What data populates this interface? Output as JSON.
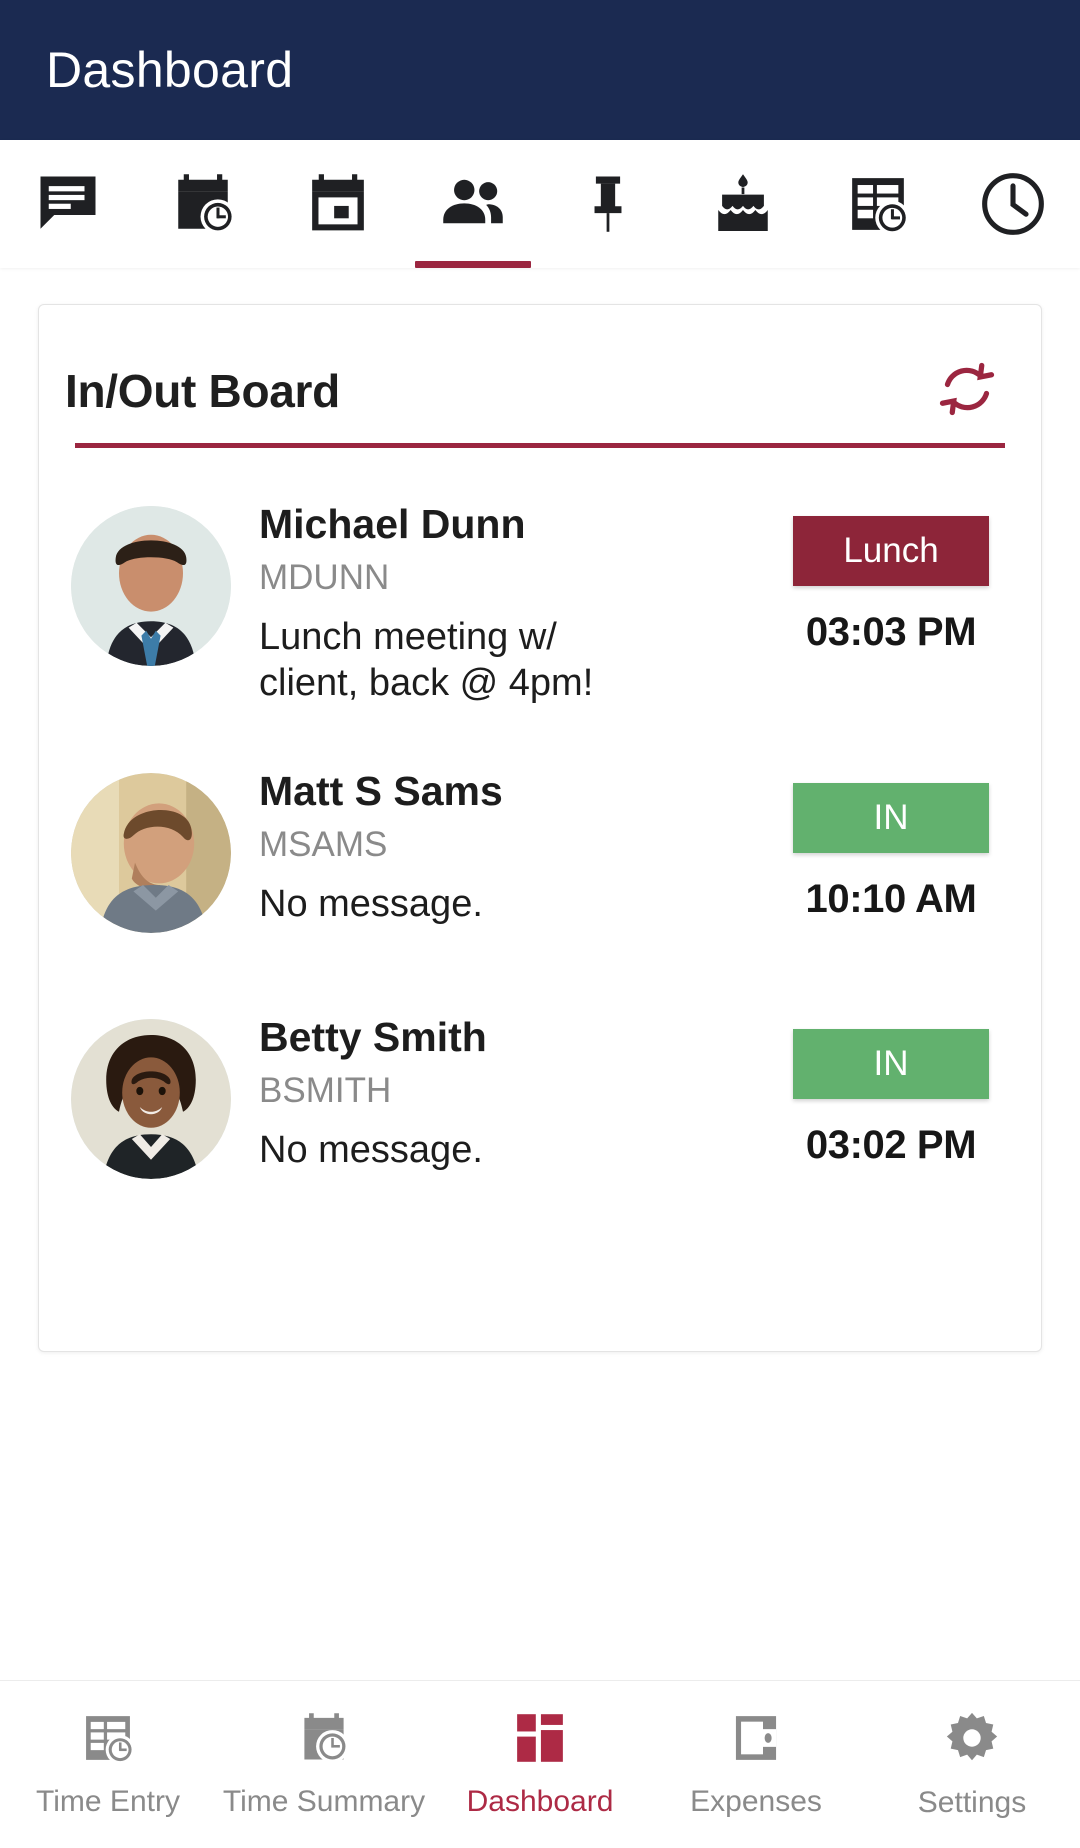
{
  "appbar": {
    "title": "Dashboard"
  },
  "colors": {
    "header_bg": "#1b2a51",
    "accent": "#9b2640",
    "badge_out": "#8d2539",
    "badge_in": "#62b16e",
    "muted_text": "#8a8a8a",
    "nav_active": "#ad2a45"
  },
  "tabs": [
    {
      "name": "messages-tab",
      "icon": "chat-bubble-icon",
      "active": false
    },
    {
      "name": "schedule-tab",
      "icon": "calendar-clock-icon",
      "active": false
    },
    {
      "name": "calendar-tab",
      "icon": "calendar-event-icon",
      "active": false
    },
    {
      "name": "in-out-board-tab",
      "icon": "people-icon",
      "active": true
    },
    {
      "name": "pinned-tab",
      "icon": "pin-icon",
      "active": false
    },
    {
      "name": "birthdays-tab",
      "icon": "cake-icon",
      "active": false
    },
    {
      "name": "timesheet-tab",
      "icon": "table-clock-icon",
      "active": false
    },
    {
      "name": "time-clock-tab",
      "icon": "clock-icon",
      "active": false
    }
  ],
  "card": {
    "title": "In/Out Board",
    "refresh_icon": "refresh-icon"
  },
  "people": [
    {
      "name": "Michael Dunn",
      "username": "MDUNN",
      "message": "Lunch meeting w/ client, back @ 4pm!",
      "status": "Lunch",
      "status_kind": "lunch",
      "time": "03:03 PM"
    },
    {
      "name": "Matt S Sams",
      "username": "MSAMS",
      "message": "No message.",
      "status": "IN",
      "status_kind": "in",
      "time": "10:10 AM"
    },
    {
      "name": "Betty Smith",
      "username": "BSMITH",
      "message": "No message.",
      "status": "IN",
      "status_kind": "in",
      "time": "03:02 PM"
    }
  ],
  "bottom_nav": [
    {
      "label": "Time Entry",
      "icon": "table-clock-icon",
      "active": false
    },
    {
      "label": "Time Summary",
      "icon": "alarm-clock-icon",
      "active": false
    },
    {
      "label": "Dashboard",
      "icon": "grid-icon",
      "active": true
    },
    {
      "label": "Expenses",
      "icon": "wallet-icon",
      "active": false
    },
    {
      "label": "Settings",
      "icon": "gear-icon",
      "active": false
    }
  ]
}
